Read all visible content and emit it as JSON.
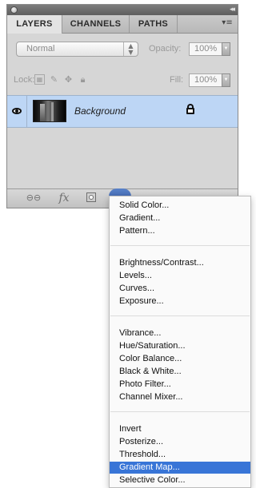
{
  "panel": {
    "tabs": [
      {
        "label": "LAYERS",
        "active": true
      },
      {
        "label": "CHANNELS",
        "active": false
      },
      {
        "label": "PATHS",
        "active": false
      }
    ],
    "blend_mode": "Normal",
    "opacity_label": "Opacity:",
    "opacity_value": "100%",
    "lock_label": "Lock:",
    "fill_label": "Fill:",
    "fill_value": "100%",
    "layers": [
      {
        "name": "Background",
        "visible": true,
        "locked": true,
        "selected": true
      }
    ],
    "bottom_icons": [
      "link-icon",
      "fx-icon",
      "mask-icon",
      "adjustment-layer-icon",
      "group-folder-icon",
      "new-layer-icon",
      "trash-icon"
    ],
    "fx_label": "fx",
    "colors": {
      "selection": "#bdd6f5",
      "menu_highlight": "#3875d7"
    }
  },
  "menu": {
    "groups": [
      [
        "Solid Color...",
        "Gradient...",
        "Pattern..."
      ],
      [
        "Brightness/Contrast...",
        "Levels...",
        "Curves...",
        "Exposure..."
      ],
      [
        "Vibrance...",
        "Hue/Saturation...",
        "Color Balance...",
        "Black & White...",
        "Photo Filter...",
        "Channel Mixer..."
      ],
      [
        "Invert",
        "Posterize...",
        "Threshold...",
        "Gradient Map...",
        "Selective Color..."
      ]
    ],
    "selected_item": "Gradient Map..."
  }
}
